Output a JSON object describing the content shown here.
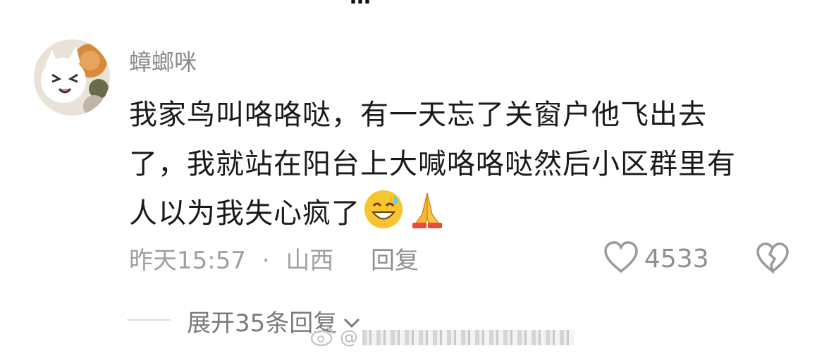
{
  "header": {
    "cut_title": "…"
  },
  "comment": {
    "username": "蟑螂咪",
    "text_line1": "我家鸟叫咯咯哒，有一天忘了关窗户他飞出去",
    "text_line2": "了，我就站在阳台上大喊咯咯哒然后小区群里有",
    "text_line3": "人以为我失心疯了",
    "emojis": [
      "grinning-sweat-emoji",
      "praying-hands-emoji"
    ],
    "time": "昨天15:57",
    "separator": "·",
    "location": "山西",
    "reply_label": "回复",
    "like_count": "4533"
  },
  "replies": {
    "expand_label": "展开35条回复"
  },
  "watermark": {
    "text": "@"
  },
  "colors": {
    "text": "#1a1a1a",
    "meta": "#a0a0a0",
    "username": "#8a8a8a"
  }
}
